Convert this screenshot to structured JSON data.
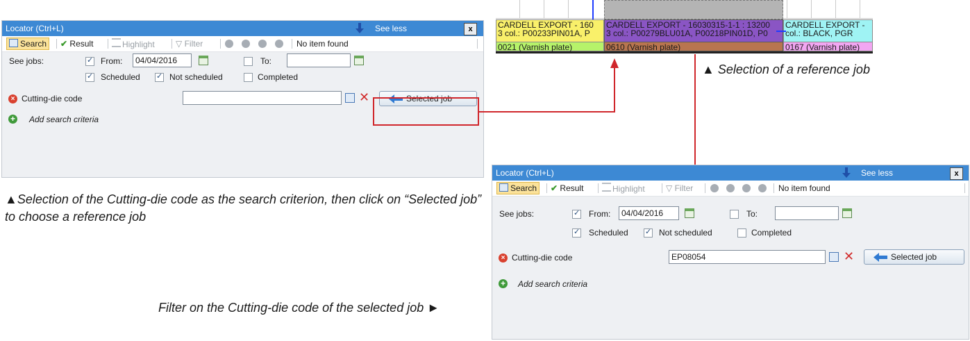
{
  "locator": {
    "title": "Locator (Ctrl+L)",
    "see_less": "See less",
    "close": "x",
    "toolbar": {
      "search": "Search",
      "result": "Result",
      "highlight": "Highlight",
      "filter": "Filter",
      "status": "No item found"
    },
    "see_jobs_label": "See jobs:",
    "from_label": "From:",
    "from_value": "04/04/2016",
    "to_label": "To:",
    "to_value": "",
    "scheduled": "Scheduled",
    "not_scheduled": "Not scheduled",
    "completed": "Completed",
    "criterion_label": "Cutting-die code",
    "selected_job": "Selected job",
    "add_criteria": "Add search criteria",
    "code_value_after": "EP08054"
  },
  "gantt": {
    "jobs": [
      {
        "line1": "CARDELL EXPORT - 160",
        "line2": "3 col.: P00233PIN01A, P",
        "op": "0021 (Varnish plate)"
      },
      {
        "line1": "CARDELL EXPORT - 16030315-1-1 : 13200",
        "line2": "3 col.: P00279BLU01A, P00218PIN01D, P0",
        "op": "0610 (Varnish plate)"
      },
      {
        "line1": "CARDELL EXPORT -",
        "line2": "col.: BLACK, PGR",
        "op": "0167 (Varnish plate)"
      }
    ]
  },
  "captions": {
    "reference": "▲ Selection of a reference job",
    "left": "▲Selection of the Cutting-die code as the search criterion, then click on “Selected job” to choose a reference job",
    "filter": "Filter on the Cutting-die code of the selected job ►"
  },
  "colors": {
    "titlebar": "#3d89d4",
    "connector": "#d0262b",
    "job_yellow": "#f9f06a",
    "job_purple": "#8a55c4",
    "job_cyan": "#9ff3f4",
    "op_green": "#b6f36a",
    "op_brown": "#b8754f",
    "op_pink": "#f2a6f2"
  }
}
